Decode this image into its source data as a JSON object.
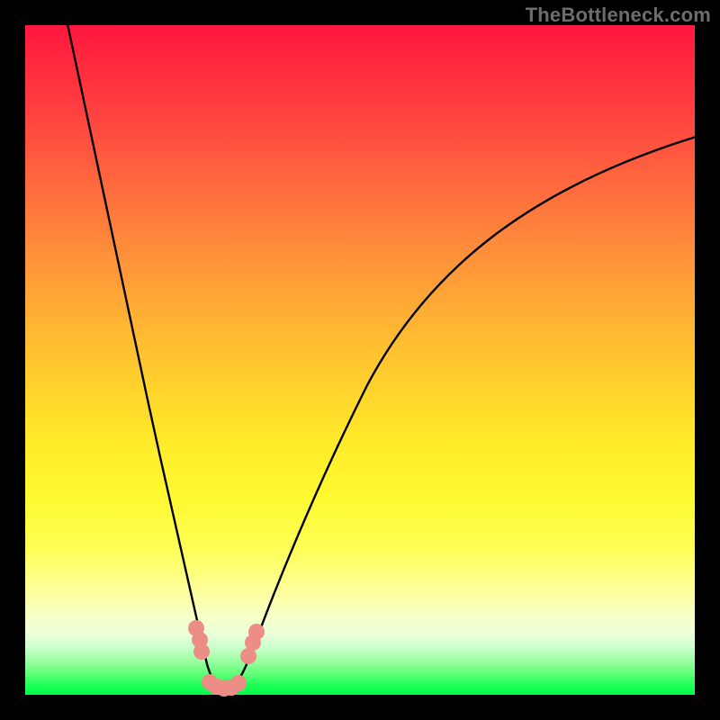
{
  "watermark": "TheBottleneck.com",
  "colors": {
    "frame": "#000000",
    "marker": "#ed8e86",
    "line": "#000000"
  },
  "chart_data": {
    "type": "line",
    "title": "",
    "xlabel": "",
    "ylabel": "",
    "xlim": [
      0,
      100
    ],
    "ylim": [
      0,
      100
    ],
    "axes_visible": false,
    "grid": false,
    "background": "vertical-gradient red (top) → green (bottom), representing performance zones",
    "series": [
      {
        "name": "left-branch",
        "description": "steep descending curve from top-left to the valley",
        "points": [
          {
            "x": 6,
            "y": 100
          },
          {
            "x": 10,
            "y": 80
          },
          {
            "x": 14,
            "y": 60
          },
          {
            "x": 18,
            "y": 40
          },
          {
            "x": 22,
            "y": 20
          },
          {
            "x": 25,
            "y": 9
          },
          {
            "x": 27,
            "y": 3
          },
          {
            "x": 29,
            "y": 0.5
          }
        ]
      },
      {
        "name": "right-branch",
        "description": "curve rising from valley toward upper-right, concave",
        "points": [
          {
            "x": 31,
            "y": 0.5
          },
          {
            "x": 34,
            "y": 5
          },
          {
            "x": 38,
            "y": 15
          },
          {
            "x": 44,
            "y": 30
          },
          {
            "x": 52,
            "y": 46
          },
          {
            "x": 62,
            "y": 60
          },
          {
            "x": 74,
            "y": 71
          },
          {
            "x": 88,
            "y": 79
          },
          {
            "x": 100,
            "y": 83
          }
        ]
      }
    ],
    "markers": [
      {
        "x": 25.5,
        "y": 9.5
      },
      {
        "x": 26.0,
        "y": 8.0
      },
      {
        "x": 26.2,
        "y": 6.5
      },
      {
        "x": 27.5,
        "y": 1.5
      },
      {
        "x": 28.5,
        "y": 1.0
      },
      {
        "x": 29.5,
        "y": 0.8
      },
      {
        "x": 30.5,
        "y": 0.8
      },
      {
        "x": 31.5,
        "y": 1.3
      },
      {
        "x": 33.0,
        "y": 5.5
      },
      {
        "x": 33.8,
        "y": 7.5
      },
      {
        "x": 34.3,
        "y": 9.0
      }
    ]
  }
}
